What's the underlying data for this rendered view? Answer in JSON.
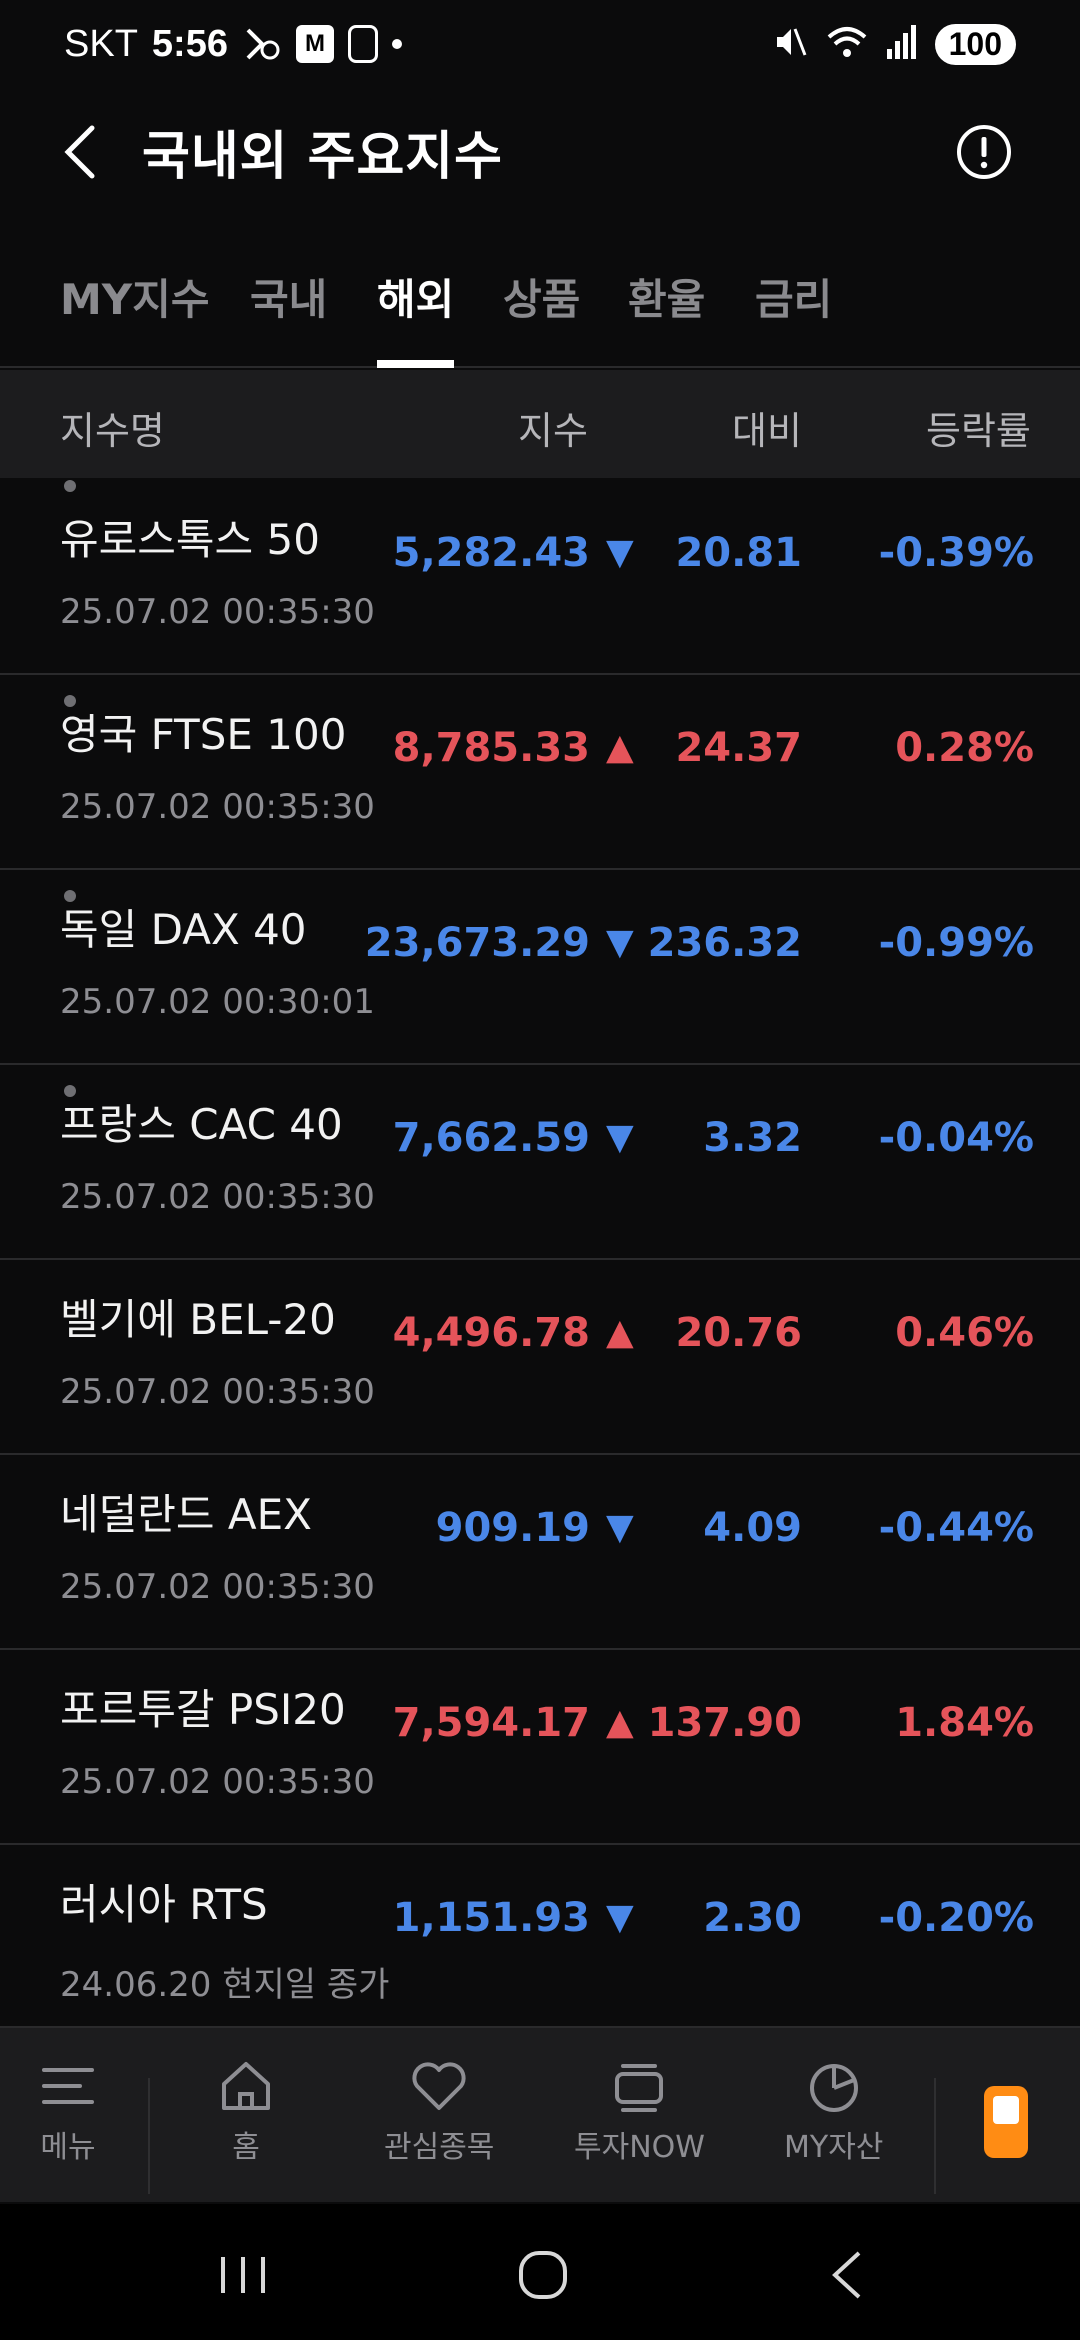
{
  "status_bar": {
    "carrier": "SKT",
    "time": "5:56",
    "m_badge": "M",
    "battery": "100"
  },
  "header": {
    "title": "국내외 주요지수"
  },
  "tabs": [
    {
      "label": "MY지수",
      "active": false
    },
    {
      "label": "국내",
      "active": false
    },
    {
      "label": "해외",
      "active": true
    },
    {
      "label": "상품",
      "active": false
    },
    {
      "label": "환율",
      "active": false
    },
    {
      "label": "금리",
      "active": false
    }
  ],
  "columns": {
    "name": "지수명",
    "index": "지수",
    "change": "대비",
    "rate": "등락률"
  },
  "rows": [
    {
      "name": "유로스톡스 50",
      "time": "25.07.02 00:35:30",
      "value": "5,282.43",
      "arrow": "▼",
      "change": "20.81",
      "rate": "-0.39%",
      "direction": "down"
    },
    {
      "name": "영국 FTSE 100",
      "time": "25.07.02 00:35:30",
      "value": "8,785.33",
      "arrow": "▲",
      "change": "24.37",
      "rate": "0.28%",
      "direction": "up"
    },
    {
      "name": "독일 DAX 40",
      "time": "25.07.02 00:30:01",
      "value": "23,673.29",
      "arrow": "▼",
      "change": "236.32",
      "rate": "-0.99%",
      "direction": "down"
    },
    {
      "name": "프랑스 CAC 40",
      "time": "25.07.02 00:35:30",
      "value": "7,662.59",
      "arrow": "▼",
      "change": "3.32",
      "rate": "-0.04%",
      "direction": "down"
    },
    {
      "name": "벨기에 BEL-20",
      "time": "25.07.02 00:35:30",
      "value": "4,496.78",
      "arrow": "▲",
      "change": "20.76",
      "rate": "0.46%",
      "direction": "up"
    },
    {
      "name": "네덜란드 AEX",
      "time": "25.07.02 00:35:30",
      "value": "909.19",
      "arrow": "▼",
      "change": "4.09",
      "rate": "-0.44%",
      "direction": "down"
    },
    {
      "name": "포르투갈 PSI20",
      "time": "25.07.02 00:35:30",
      "value": "7,594.17",
      "arrow": "▲",
      "change": "137.90",
      "rate": "1.84%",
      "direction": "up"
    },
    {
      "name": "러시아 RTS",
      "time": "24.06.20 현지일 종가",
      "value": "1,151.93",
      "arrow": "▼",
      "change": "2.30",
      "rate": "-0.20%",
      "direction": "down"
    }
  ],
  "bottom_nav": [
    {
      "label": "메뉴",
      "icon": "menu-icon"
    },
    {
      "label": "홈",
      "icon": "home-icon"
    },
    {
      "label": "관심종목",
      "icon": "heart-icon"
    },
    {
      "label": "투자NOW",
      "icon": "stack-icon"
    },
    {
      "label": "MY자산",
      "icon": "pie-chart-icon"
    }
  ],
  "colors": {
    "down": "#4a87e8",
    "up": "#e5545a",
    "accent": "#ff8c14",
    "background": "#0b0b0c"
  }
}
